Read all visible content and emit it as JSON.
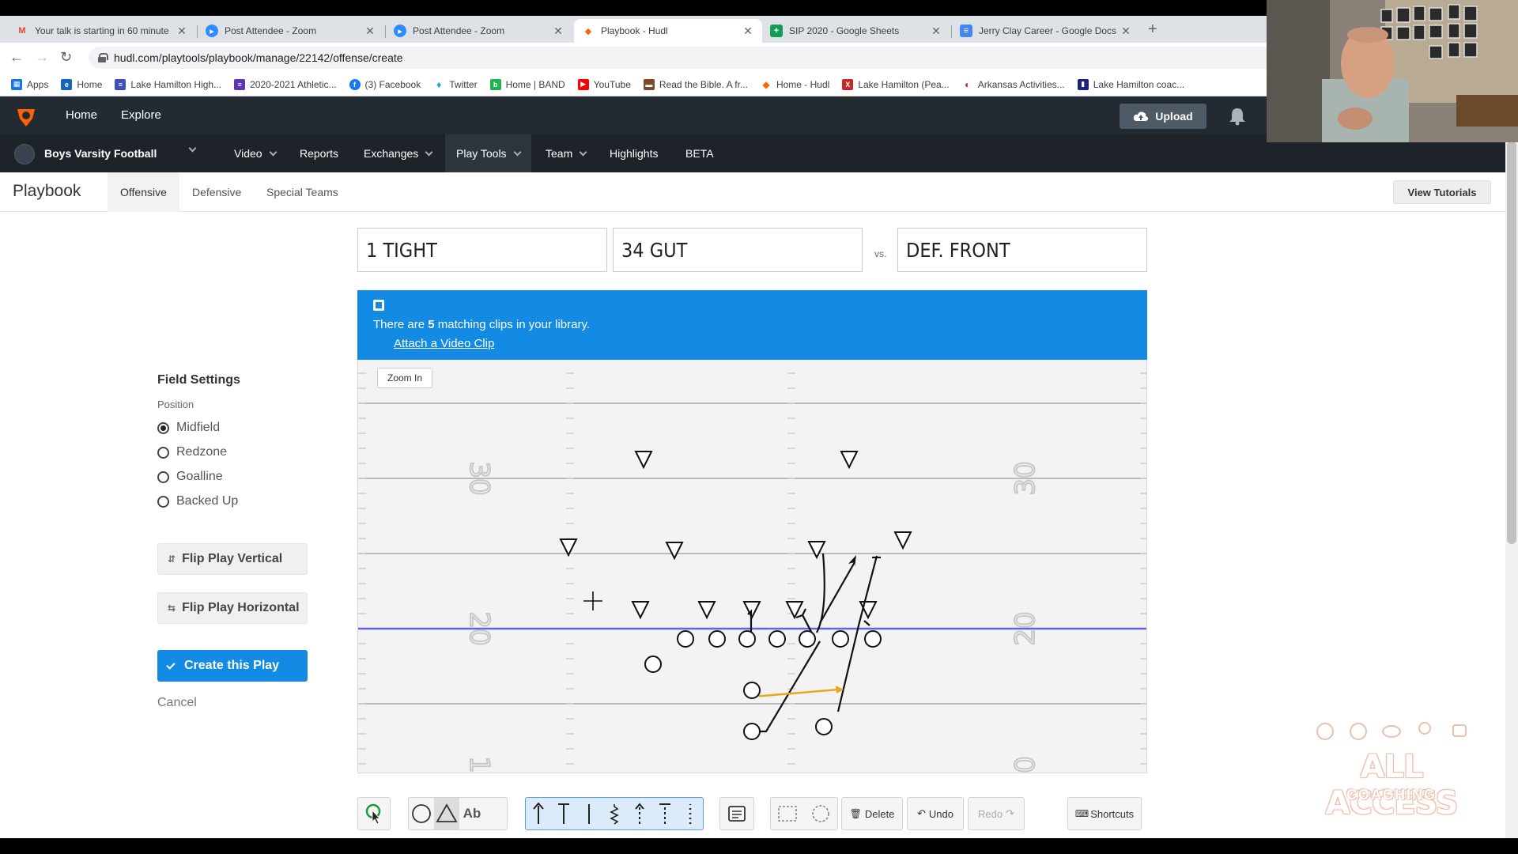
{
  "browser": {
    "tabs": [
      {
        "label": "Your talk is starting in 60 minute",
        "icon": "gmail-icon",
        "active": false
      },
      {
        "label": "Post Attendee - Zoom",
        "icon": "zoom-icon",
        "active": false
      },
      {
        "label": "Post Attendee - Zoom",
        "icon": "zoom-icon",
        "active": false
      },
      {
        "label": "Playbook - Hudl",
        "icon": "hudl-icon",
        "active": true
      },
      {
        "label": "SIP 2020 - Google Sheets",
        "icon": "sheets-icon",
        "active": false
      },
      {
        "label": "Jerry Clay Career - Google Docs",
        "icon": "docs-icon",
        "active": false
      }
    ],
    "new_tab": "+",
    "url": "hudl.com/playtools/playbook/manage/22142/offense/create",
    "bookmarks": [
      {
        "label": "Apps",
        "color": "#1a73e8"
      },
      {
        "label": "Home",
        "color": "#1565c0"
      },
      {
        "label": "Lake Hamilton High...",
        "color": "#3f51b5"
      },
      {
        "label": "2020-2021 Athletic...",
        "color": "#5e35b1"
      },
      {
        "label": "(3) Facebook",
        "color": "#1877f2"
      },
      {
        "label": "Twitter",
        "color": "#1da1f2"
      },
      {
        "label": "Home | BAND",
        "color": "#22b14c"
      },
      {
        "label": "YouTube",
        "color": "#ff0000"
      },
      {
        "label": "Read the Bible. A fr...",
        "color": "#7b4a2a"
      },
      {
        "label": "Home - Hudl",
        "color": "#ff6600"
      },
      {
        "label": "Lake Hamilton (Pea...",
        "color": "#c62828"
      },
      {
        "label": "Arkansas Activities...",
        "color": "#b71c1c"
      },
      {
        "label": "Lake Hamilton coac...",
        "color": "#1a237e"
      }
    ]
  },
  "hudl": {
    "top_nav": [
      "Home",
      "Explore"
    ],
    "upload_label": "Upload",
    "team_name": "Boys Varsity Football",
    "sub_nav": [
      {
        "label": "Video",
        "dropdown": true
      },
      {
        "label": "Reports",
        "dropdown": false
      },
      {
        "label": "Exchanges",
        "dropdown": true
      },
      {
        "label": "Play Tools",
        "dropdown": true
      },
      {
        "label": "Team",
        "dropdown": true
      },
      {
        "label": "Highlights",
        "dropdown": false
      },
      {
        "label": "BETA",
        "dropdown": false
      }
    ],
    "brand_color": "#ff6300"
  },
  "playbook": {
    "title": "Playbook",
    "tabs": [
      "Offensive",
      "Defensive",
      "Special Teams"
    ],
    "active_tab": "Offensive",
    "view_tutorials": "View Tutorials",
    "formation": "1 TIGHT",
    "play_name": "34 GUT",
    "vs_label": "vs.",
    "def_front": "DEF. FRONT"
  },
  "banner": {
    "text_prefix": "There are",
    "count": "5",
    "text_suffix": "matching clips in your library.",
    "link": "Attach a Video Clip"
  },
  "field": {
    "zoom_label": "Zoom In",
    "yard_labels": [
      "30",
      "20"
    ],
    "bottom_marks": [
      "1",
      "0"
    ]
  },
  "settings": {
    "title": "Field Settings",
    "position_label": "Position",
    "positions": [
      "Midfield",
      "Redzone",
      "Goalline",
      "Backed Up"
    ],
    "selected": "Midfield",
    "flip_vertical": "Flip Play Vertical",
    "flip_horizontal": "Flip Play Horizontal",
    "create": "Create this Play",
    "cancel": "Cancel"
  },
  "toolbar": {
    "text_tool": "Ab",
    "delete": "Delete",
    "undo": "Undo",
    "redo": "Redo",
    "shortcuts": "Shortcuts"
  },
  "watermark": {
    "line1": "ALL ACCESS",
    "line2": "COACHING"
  }
}
